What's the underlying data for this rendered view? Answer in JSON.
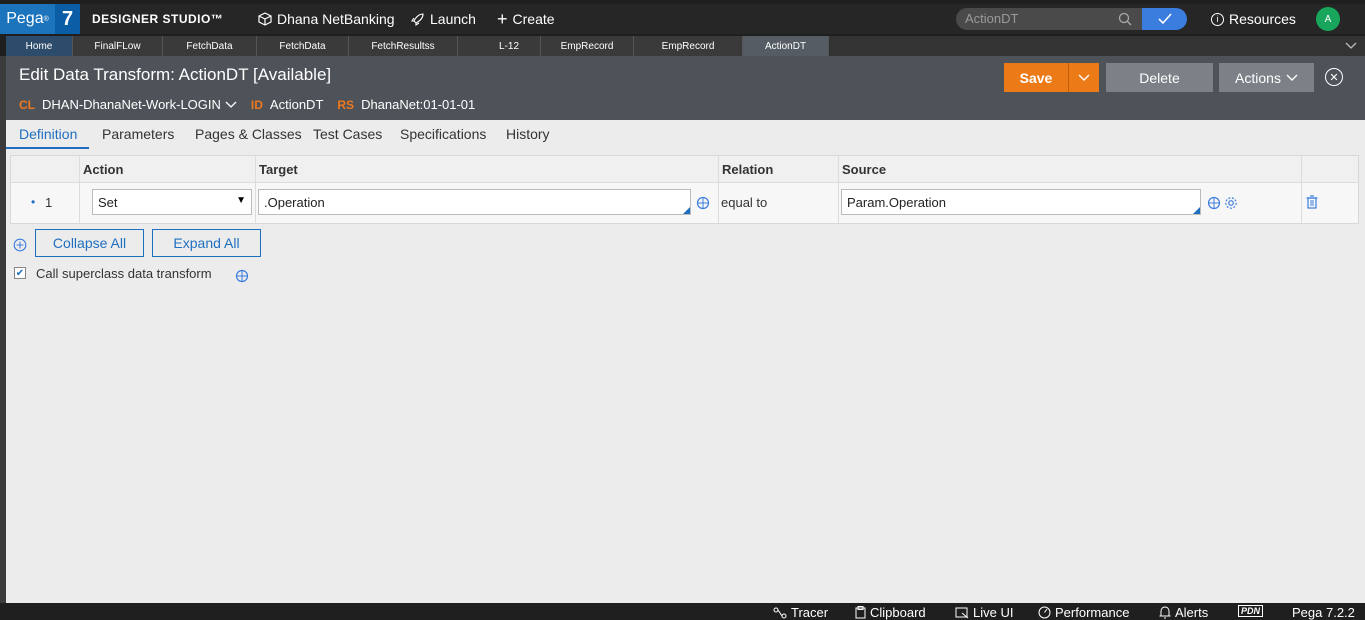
{
  "topbar": {
    "logo_pega": "Pega",
    "logo_reg": "®",
    "logo_version": "7",
    "studio": "DESIGNER STUDIO™",
    "app_name": "Dhana NetBanking",
    "launch": "Launch",
    "create": "Create",
    "search_value": "ActionDT",
    "resources": "Resources",
    "avatar_initial": "A"
  },
  "worktabs": [
    "Home",
    "FinalFLow",
    "FetchData",
    "FetchData",
    "FetchResultss",
    "L-12",
    "EmpRecord",
    "EmpRecord",
    "ActionDT"
  ],
  "header": {
    "title": "Edit  Data Transform:  ActionDT [Available]",
    "cl_key": "CL",
    "cl_value": "DHAN-DhanaNet-Work-LOGIN",
    "id_key": "ID",
    "id_value": "ActionDT",
    "rs_key": "RS",
    "rs_value": "DhanaNet:01-01-01",
    "save": "Save",
    "delete": "Delete",
    "actions": "Actions"
  },
  "subtabs": [
    "Definition",
    "Parameters",
    "Pages & Classes",
    "Test Cases",
    "Specifications",
    "History"
  ],
  "grid": {
    "headers": {
      "action": "Action",
      "target": "Target",
      "relation": "Relation",
      "source": "Source"
    },
    "row": {
      "index": "1",
      "action": "Set",
      "target": ".Operation",
      "relation": "equal to",
      "source": "Param.Operation"
    }
  },
  "controls": {
    "collapse_all": "Collapse All",
    "expand_all": "Expand All",
    "superclass_label": "Call superclass data transform",
    "superclass_checked": true
  },
  "footer": {
    "tracer": "Tracer",
    "clipboard": "Clipboard",
    "live_ui": "Live UI",
    "performance": "Performance",
    "alerts": "Alerts",
    "pdn": "PDN",
    "version": "Pega 7.2.2"
  },
  "colors": {
    "accent_blue": "#1f6fc0",
    "save_orange": "#eb7a17",
    "header_gray": "#4d5358"
  }
}
